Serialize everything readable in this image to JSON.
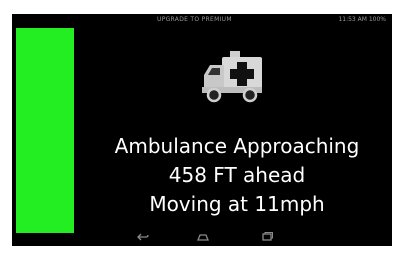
{
  "status_bar": {
    "center_text": "UPGRADE TO PREMIUM",
    "right_text": "11:53 AM 100%"
  },
  "alert": {
    "line1": "Ambulance Approaching",
    "line2": "458 FT ahead",
    "line3": "Moving at 11mph"
  },
  "indicator": {
    "color": "#22ee22"
  },
  "icons": {
    "vehicle": "ambulance-icon",
    "nav": [
      "back-icon",
      "home-icon",
      "recent-apps-icon"
    ]
  }
}
